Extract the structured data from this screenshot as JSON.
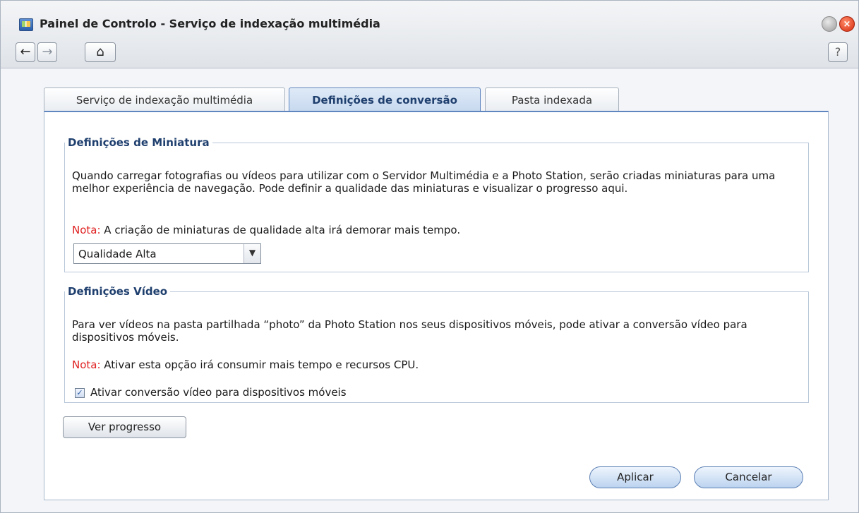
{
  "window": {
    "title": "Painel de Controlo - Serviço de indexação multimédia",
    "help_label": "?",
    "nav": {
      "back": "←",
      "forward": "→",
      "home": "⌂"
    }
  },
  "tabs": [
    {
      "label": "Serviço de indexação multimédia",
      "active": false
    },
    {
      "label": "Definições de conversão",
      "active": true
    },
    {
      "label": "Pasta indexada",
      "active": false
    }
  ],
  "thumbnail_section": {
    "title": "Definições de Miniatura",
    "description": "Quando carregar fotografias ou vídeos para utilizar com o Servidor Multimédia e a Photo Station, serão criadas miniaturas para uma melhor experiência de navegação. Pode definir a qualidade das miniaturas e visualizar o progresso aqui.",
    "note_label": "Nota:",
    "note_text": " A criação de miniaturas de qualidade alta irá demorar mais tempo.",
    "quality_select": {
      "value": "Qualidade Alta"
    }
  },
  "video_section": {
    "title": "Definições Vídeo",
    "description": "Para ver vídeos na pasta partilhada “photo” da Photo Station nos seus dispositivos móveis, pode ativar a conversão vídeo para dispositivos móveis.",
    "note_label": "Nota:",
    "note_text": " Ativar esta opção irá consumir mais tempo e recursos CPU.",
    "checkbox": {
      "label": "Ativar conversão vídeo para dispositivos móveis",
      "checked": true
    }
  },
  "buttons": {
    "view_progress": "Ver progresso",
    "apply": "Aplicar",
    "cancel": "Cancelar"
  },
  "colors": {
    "note": "#e02222",
    "accent": "#1f3f6e",
    "active_tab": "#c6d8ef"
  }
}
